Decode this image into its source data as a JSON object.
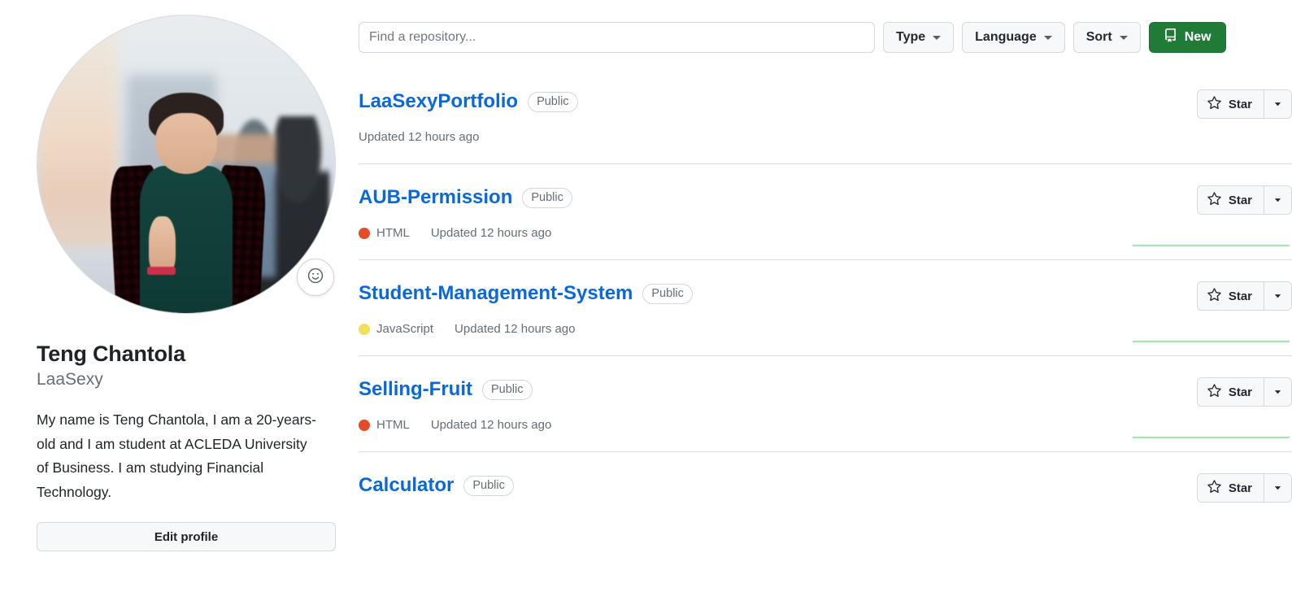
{
  "profile": {
    "avatar_alt": "Teng Chantola avatar photo",
    "status_emoji_icon": "smiley-face-icon",
    "display_name": "Teng Chantola",
    "login": "LaaSexy",
    "bio": "My name is Teng Chantola, I am a 20-years-old and I am student at ACLEDA University of Business. I am studying Financial Technology.",
    "edit_profile_label": "Edit profile"
  },
  "toolbar": {
    "search_placeholder": "Find a repository...",
    "search_value": "",
    "type_label": "Type",
    "language_label": "Language",
    "sort_label": "Sort",
    "new_label": "New",
    "new_icon": "repo-book-icon",
    "new_button_color": "#1f7b36"
  },
  "repo_actions": {
    "star_label": "Star",
    "star_icon": "star-outline-icon",
    "dropdown_icon": "triangle-down-icon"
  },
  "colors": {
    "link_blue": "#0969da",
    "muted_text": "#656d76",
    "border": "#d8dee4",
    "sparkline_green": "#a6e5b4",
    "html_dot": "#e34c26",
    "javascript_dot": "#f1e05a"
  },
  "repositories": [
    {
      "name": "LaaSexyPortfolio",
      "visibility": "Public",
      "language": null,
      "language_color": null,
      "updated": "Updated 12 hours ago",
      "has_sparkline": false
    },
    {
      "name": "AUB-Permission",
      "visibility": "Public",
      "language": "HTML",
      "language_color": "#e34c26",
      "updated": "Updated 12 hours ago",
      "has_sparkline": true
    },
    {
      "name": "Student-Management-System",
      "visibility": "Public",
      "language": "JavaScript",
      "language_color": "#f1e05a",
      "updated": "Updated 12 hours ago",
      "has_sparkline": true
    },
    {
      "name": "Selling-Fruit",
      "visibility": "Public",
      "language": "HTML",
      "language_color": "#e34c26",
      "updated": "Updated 12 hours ago",
      "has_sparkline": true
    },
    {
      "name": "Calculator",
      "visibility": "Public",
      "language": null,
      "language_color": null,
      "updated": "",
      "has_sparkline": false
    }
  ]
}
